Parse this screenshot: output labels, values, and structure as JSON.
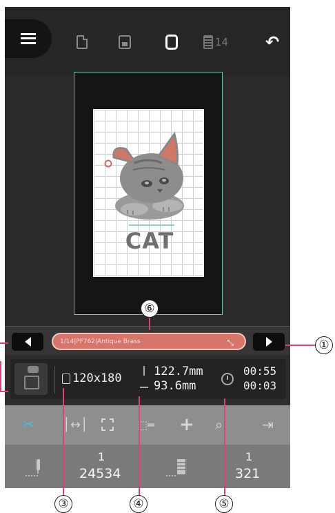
{
  "toolbar": {
    "menu_icon": "menu-icon",
    "new_icon": "new-file-icon",
    "save_icon": "save-icon",
    "hoop_icon": "hoop-icon",
    "spool_icon": "thread-spool-icon",
    "spool_count": "14",
    "undo_icon": "undo-icon"
  },
  "canvas": {
    "design_text": "CAT"
  },
  "thread": {
    "label": "1/14|PF762|Antique Brass",
    "pill_color": "#d8756a"
  },
  "info": {
    "size": "120x180",
    "width_mm": "122.7mm",
    "height_mm": "93.6mm",
    "time_total": "00:55",
    "time_remaining": "00:03"
  },
  "tools": [
    {
      "name": "cut-tool-icon",
      "active": true
    },
    {
      "name": "align-tool-icon"
    },
    {
      "name": "select-tool-icon"
    },
    {
      "name": "trace-tool-icon"
    },
    {
      "name": "move-tool-icon"
    },
    {
      "name": "zoom-tool-icon"
    },
    {
      "name": "exit-tool-icon"
    }
  ],
  "counters": {
    "stitch_index": "1",
    "stitch_total": "24534",
    "color_index": "1",
    "color_total": "321"
  },
  "callouts": [
    "①",
    "③",
    "④",
    "⑤",
    "⑥"
  ],
  "accent_color": "#4fb6e0",
  "callout_color": "#e0407a"
}
